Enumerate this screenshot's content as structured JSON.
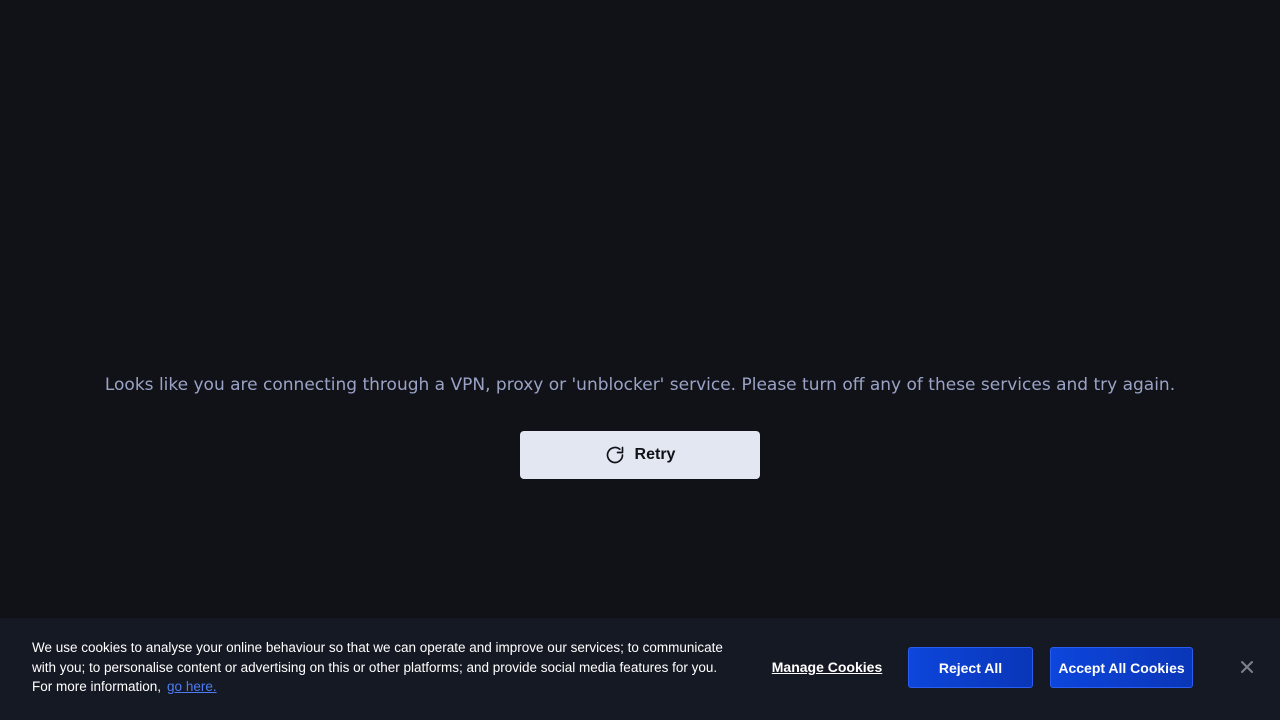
{
  "main": {
    "message": "Looks like you are connecting through a VPN, proxy or 'unblocker' service. Please turn off any of these services and try again.",
    "retry_label": "Retry",
    "retry_icon": "refresh-icon"
  },
  "cookie_banner": {
    "text": "We use cookies to analyse your online behaviour so that we can operate and improve our services; to communicate with you; to personalise content or advertising on this or other platforms; and provide social media features for you. For more information,",
    "link_text": "go here.",
    "manage_label": "Manage Cookies",
    "reject_label": "Reject All",
    "accept_label": "Accept All Cookies",
    "close_icon": "close-icon"
  },
  "colors": {
    "background": "#111217",
    "message_text": "#9aa3c6",
    "retry_button_bg": "#e2e7f2",
    "banner_bg": "#151923",
    "primary_button": "#0d46dc",
    "link": "#4d7cf5"
  }
}
